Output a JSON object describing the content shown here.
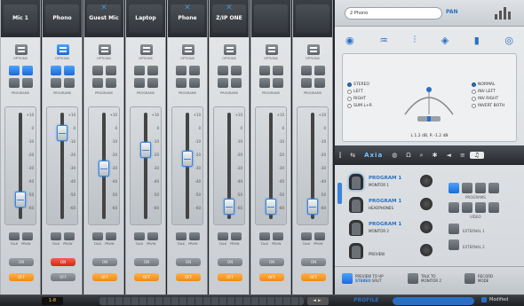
{
  "strips": [
    {
      "name": "Mic 1",
      "preset_marker": false,
      "options_on": false,
      "prog_on": [
        true,
        true,
        false,
        false
      ],
      "fader": 0.86,
      "on_red": false,
      "off_orange": true
    },
    {
      "name": "Phono",
      "preset_marker": false,
      "options_on": true,
      "prog_on": [
        true,
        true,
        false,
        false
      ],
      "fader": 0.13,
      "on_red": true,
      "off_orange": false
    },
    {
      "name": "Guest Mic",
      "preset_marker": true,
      "options_on": false,
      "prog_on": [
        false,
        false,
        false,
        false
      ],
      "fader": 0.52,
      "on_red": false,
      "off_orange": true
    },
    {
      "name": "Laptop",
      "preset_marker": false,
      "options_on": false,
      "prog_on": [
        false,
        false,
        false,
        false
      ],
      "fader": 0.32,
      "on_red": false,
      "off_orange": true
    },
    {
      "name": "Phone",
      "preset_marker": true,
      "options_on": false,
      "prog_on": [
        false,
        false,
        false,
        false
      ],
      "fader": 0.41,
      "on_red": false,
      "off_orange": true
    },
    {
      "name": "Z/IP ONE",
      "preset_marker": true,
      "options_on": false,
      "prog_on": [
        false,
        false,
        false,
        false
      ],
      "fader": 0.93,
      "on_red": false,
      "off_orange": true
    },
    {
      "name": "",
      "preset_marker": false,
      "options_on": false,
      "prog_on": [
        false,
        false,
        false,
        false
      ],
      "fader": 0.93,
      "on_red": false,
      "off_orange": true
    },
    {
      "name": "",
      "preset_marker": false,
      "options_on": false,
      "prog_on": [
        false,
        false,
        false,
        false
      ],
      "fader": 0.93,
      "on_red": false,
      "off_orange": true
    }
  ],
  "strip_labels": {
    "options": "OPTIONS",
    "programs": "PROGRAMS",
    "talk_prvw": "TALK PRVW",
    "on": "ON",
    "off": "OFF"
  },
  "scale_ticks": [
    "+10",
    "0",
    "-10",
    "-20",
    "-30",
    "-40",
    "-50",
    "-60"
  ],
  "panel": {
    "input_name": "2  Phono",
    "pan_label": "PAN",
    "pan_modes": [
      "STEREO",
      "LEFT",
      "RIGHT",
      "SUM L+R"
    ],
    "pan_mode_selected": 0,
    "phase_modes": [
      "NORMAL",
      "INV LEFT",
      "INV RIGHT",
      "INVERT BOTH"
    ],
    "phase_mode_selected": 0,
    "pan_readout": "L 1.2 dB, R -1.2 dB",
    "tabs": [
      "Axia"
    ],
    "monitors": [
      {
        "title": "PROGRAM 1",
        "sub": "MONITOR 1",
        "selected": true
      },
      {
        "title": "PROGRAM 1",
        "sub": "HEADPHONES",
        "selected": false
      },
      {
        "title": "PROGRAM 1",
        "sub": "MONITOR 2",
        "selected": false
      },
      {
        "title": "",
        "sub": "PREVIEW",
        "selected": false
      }
    ],
    "programs_label": "PROGRAMS",
    "video_label": "VIDEO",
    "external_1": "EXTERNAL 1",
    "external_2": "EXTERNAL 2",
    "footer": {
      "preview_cue": "PREVIEW TO HP",
      "stereo": "STEREO",
      "split": "SPLIT",
      "talk": "TALK TO MONITOR 2",
      "record": "RECORD MODE"
    }
  },
  "bottom": {
    "number": "1-8",
    "profile_label": "PROFILE",
    "profile_value": "",
    "modified": "Modified"
  },
  "colors": {
    "accent_blue": "#2a6fc4",
    "on_red": "#d3261b",
    "off_orange": "#f08a14",
    "display_yellow": "#ffcf3a"
  }
}
